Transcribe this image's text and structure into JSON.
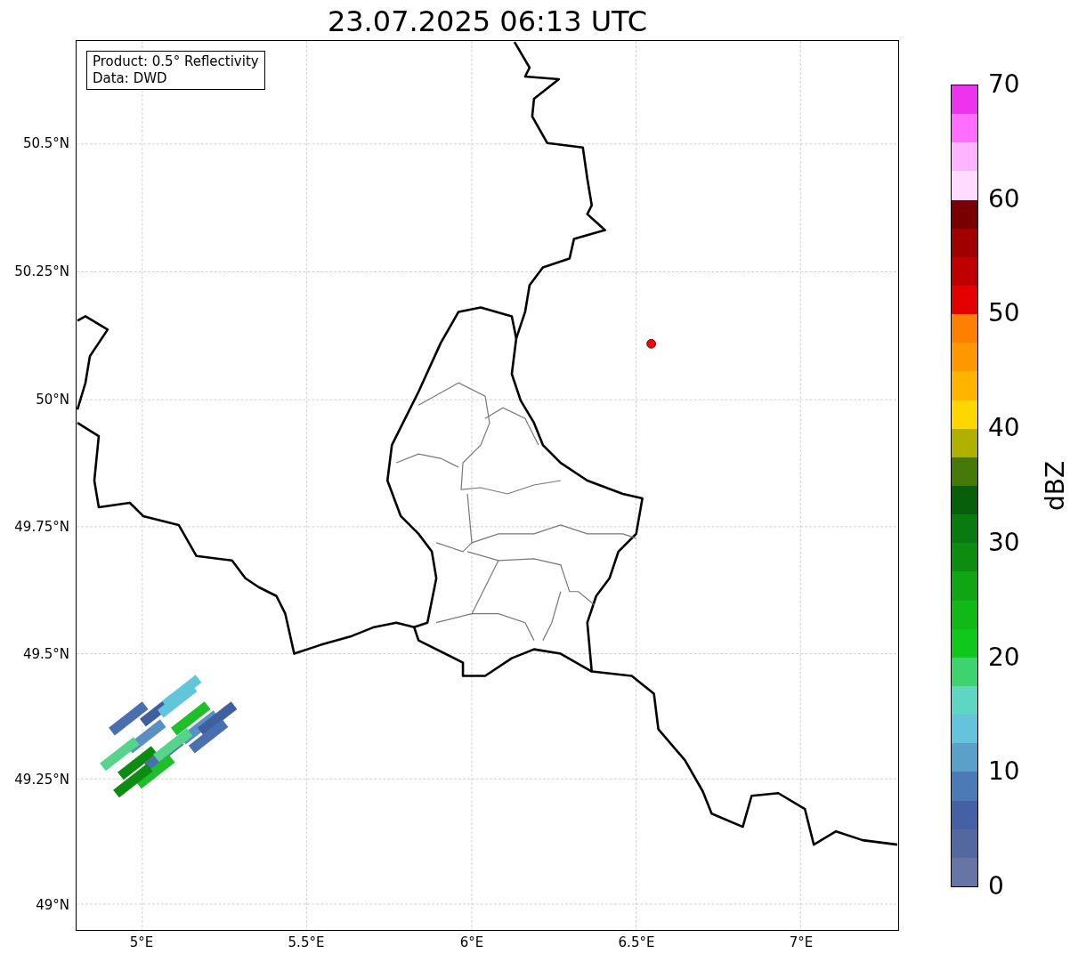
{
  "title": "23.07.2025 06:13 UTC",
  "legend": [
    "Product: 0.5° Reflectivity",
    "Data: DWD"
  ],
  "map": {
    "lat_ticks": [
      "50.5°N",
      "50.25°N",
      "50°N",
      "49.75°N",
      "49.5°N",
      "49.25°N",
      "49°N"
    ],
    "lon_ticks": [
      "5°E",
      "5.5°E",
      "6°E",
      "6.5°E",
      "7°E"
    ]
  },
  "colorbar": {
    "label": "dBZ",
    "ticks": [
      "70",
      "60",
      "50",
      "40",
      "30",
      "20",
      "10",
      "0"
    ],
    "bands": [
      {
        "color": "#ee33ee"
      },
      {
        "color": "#ff6eff"
      },
      {
        "color": "#ffb4ff"
      },
      {
        "color": "#ffdcff"
      },
      {
        "color": "#780000"
      },
      {
        "color": "#a00000"
      },
      {
        "color": "#c00000"
      },
      {
        "color": "#e30000"
      },
      {
        "color": "#ff7f00"
      },
      {
        "color": "#ff9800"
      },
      {
        "color": "#ffb500"
      },
      {
        "color": "#ffd700"
      },
      {
        "color": "#b0b000"
      },
      {
        "color": "#457a0a"
      },
      {
        "color": "#075e0b"
      },
      {
        "color": "#0a7a10"
      },
      {
        "color": "#0e8c12"
      },
      {
        "color": "#10a514"
      },
      {
        "color": "#10b818"
      },
      {
        "color": "#10c81c"
      },
      {
        "color": "#3dd36e"
      },
      {
        "color": "#5fd6c4"
      },
      {
        "color": "#66c3dc"
      },
      {
        "color": "#5ba0c8"
      },
      {
        "color": "#4b7ab5"
      },
      {
        "color": "#4560a5"
      },
      {
        "color": "#5468a0"
      },
      {
        "color": "#6675a6"
      }
    ]
  }
}
